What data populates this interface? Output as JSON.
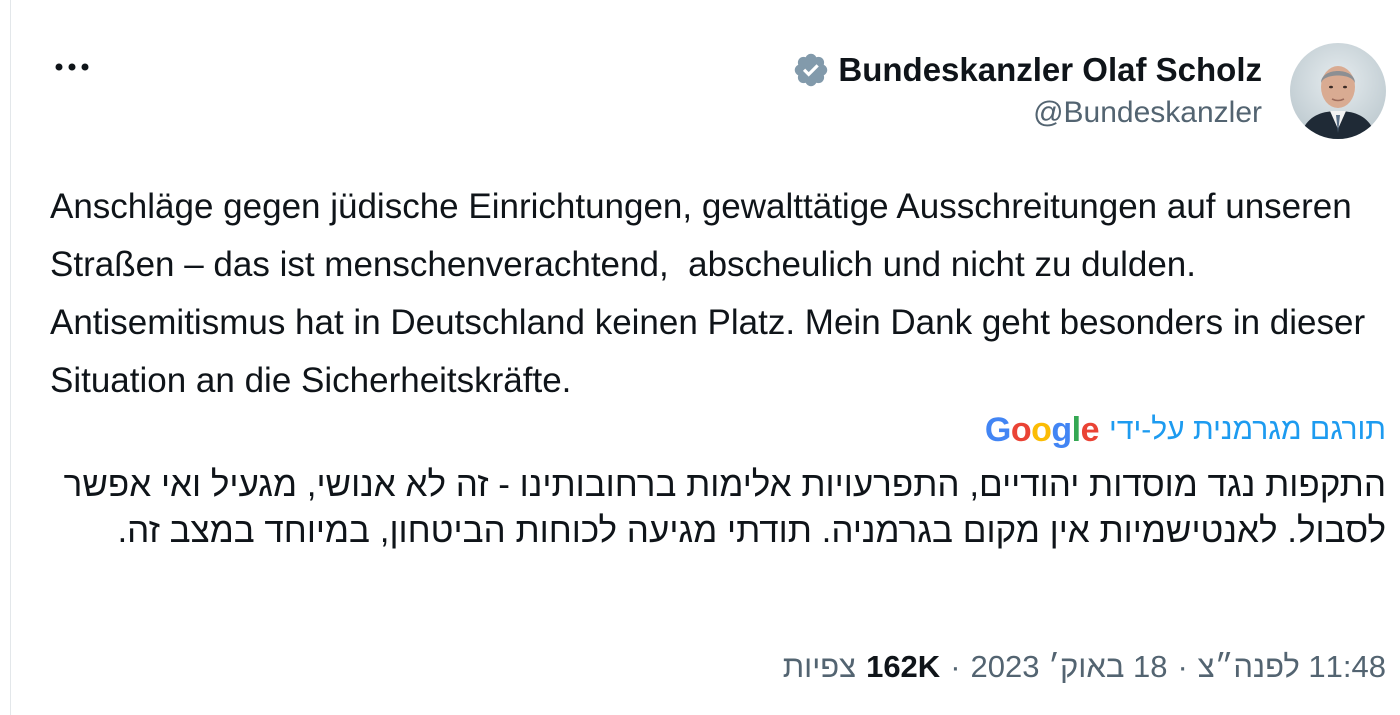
{
  "tweet": {
    "author": {
      "display_name": "Bundeskanzler Olaf Scholz",
      "handle": "@Bundeskanzler",
      "verified_icon": "verified-badge-icon",
      "avatar_icon": "profile-photo"
    },
    "more_icon": "more-options-icon",
    "text": "Anschläge gegen jüdische Einrichtungen, gewalttätige Ausschreitungen auf unseren Straßen – das ist menschenverachtend,  abscheulich und nicht zu dulden. Antisemitismus hat in Deutschland keinen Platz. Mein Dank geht besonders in dieser Situation an die Sicherheitskräfte.",
    "translation": {
      "label": "תורגם מגרמנית על-ידי",
      "provider": "Google",
      "text": "התקפות נגד מוסדות יהודיים, התפרעויות אלימות ברחובותינו - זה לא אנושי, מגעיל ואי אפשר לסבול. לאנטישמיות אין מקום בגרמניה. תודתי מגיעה לכוחות הביטחון, במיוחד במצב זה."
    },
    "meta": {
      "time": "11:48 לפנה״צ",
      "date": "18 באוק׳ 2023",
      "separator": "·",
      "views_count": "162K",
      "views_label": "צפיות"
    }
  },
  "colors": {
    "text_primary": "#0f1419",
    "text_secondary": "#536471",
    "link_blue": "#1d9bf0",
    "verified_badge": "#829aab"
  }
}
